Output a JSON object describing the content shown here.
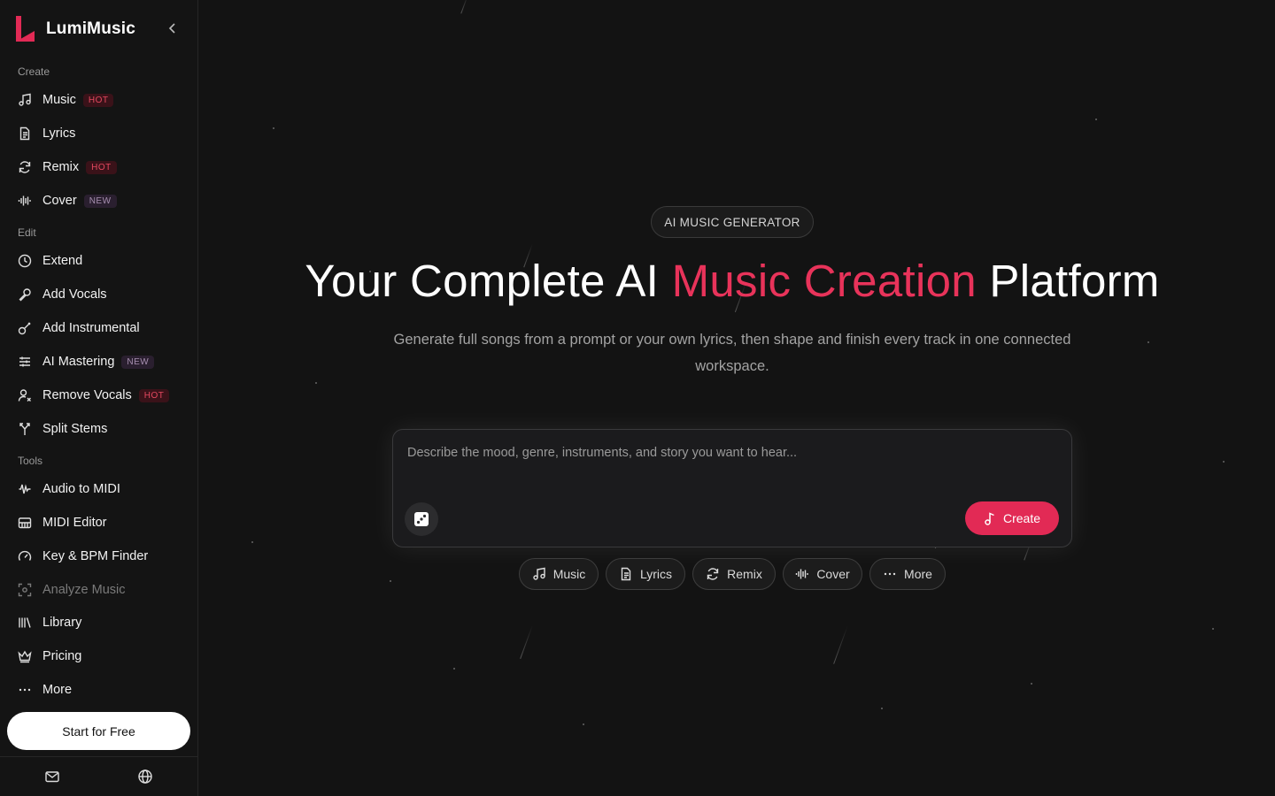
{
  "app": {
    "name": "LumiMusic"
  },
  "colors": {
    "accent": "#e8335a",
    "background": "#131313",
    "sidebar": "#141414",
    "hot_badge": "#e4485f",
    "new_badge": "#a78fb0"
  },
  "sidebar": {
    "sections": {
      "create": "Create",
      "edit": "Edit",
      "tools": "Tools"
    },
    "create_items": [
      {
        "label": "Music",
        "icon": "music-note-icon",
        "badge": "HOT"
      },
      {
        "label": "Lyrics",
        "icon": "document-icon",
        "badge": ""
      },
      {
        "label": "Remix",
        "icon": "refresh-icon",
        "badge": "HOT"
      },
      {
        "label": "Cover",
        "icon": "waveform-icon",
        "badge": "NEW"
      }
    ],
    "edit_items": [
      {
        "label": "Extend",
        "icon": "clock-icon",
        "badge": ""
      },
      {
        "label": "Add Vocals",
        "icon": "microphone-icon",
        "badge": ""
      },
      {
        "label": "Add Instrumental",
        "icon": "guitar-icon",
        "badge": ""
      },
      {
        "label": "AI Mastering",
        "icon": "sliders-icon",
        "badge": "NEW"
      },
      {
        "label": "Remove Vocals",
        "icon": "user-remove-icon",
        "badge": "HOT"
      },
      {
        "label": "Split Stems",
        "icon": "split-icon",
        "badge": ""
      }
    ],
    "tools_items": [
      {
        "label": "Audio to MIDI",
        "icon": "audio-wave-icon"
      },
      {
        "label": "MIDI Editor",
        "icon": "piano-icon"
      },
      {
        "label": "Key & BPM Finder",
        "icon": "gauge-icon"
      },
      {
        "label": "Analyze Music",
        "icon": "scan-icon"
      },
      {
        "label": "Library",
        "icon": "library-icon"
      },
      {
        "label": "Pricing",
        "icon": "crown-icon"
      },
      {
        "label": "More",
        "icon": "more-dots-icon"
      }
    ],
    "start_button": "Start for Free",
    "footer_icons": [
      "mail-icon",
      "globe-icon"
    ]
  },
  "hero": {
    "tag": "AI MUSIC GENERATOR",
    "title_part1": "Your Complete AI ",
    "title_accent": "Music Creation",
    "title_part2": " Platform",
    "subtitle": "Generate full songs from a prompt or your own lyrics, then shape and finish every track in one connected workspace."
  },
  "prompt": {
    "placeholder": "Describe the mood, genre, instruments, and story you want to hear...",
    "value": "",
    "create_label": "Create"
  },
  "chips": [
    {
      "label": "Music",
      "icon": "music-note-icon"
    },
    {
      "label": "Lyrics",
      "icon": "document-icon"
    },
    {
      "label": "Remix",
      "icon": "refresh-icon"
    },
    {
      "label": "Cover",
      "icon": "waveform-icon"
    },
    {
      "label": "More",
      "icon": "more-dots-icon"
    }
  ]
}
